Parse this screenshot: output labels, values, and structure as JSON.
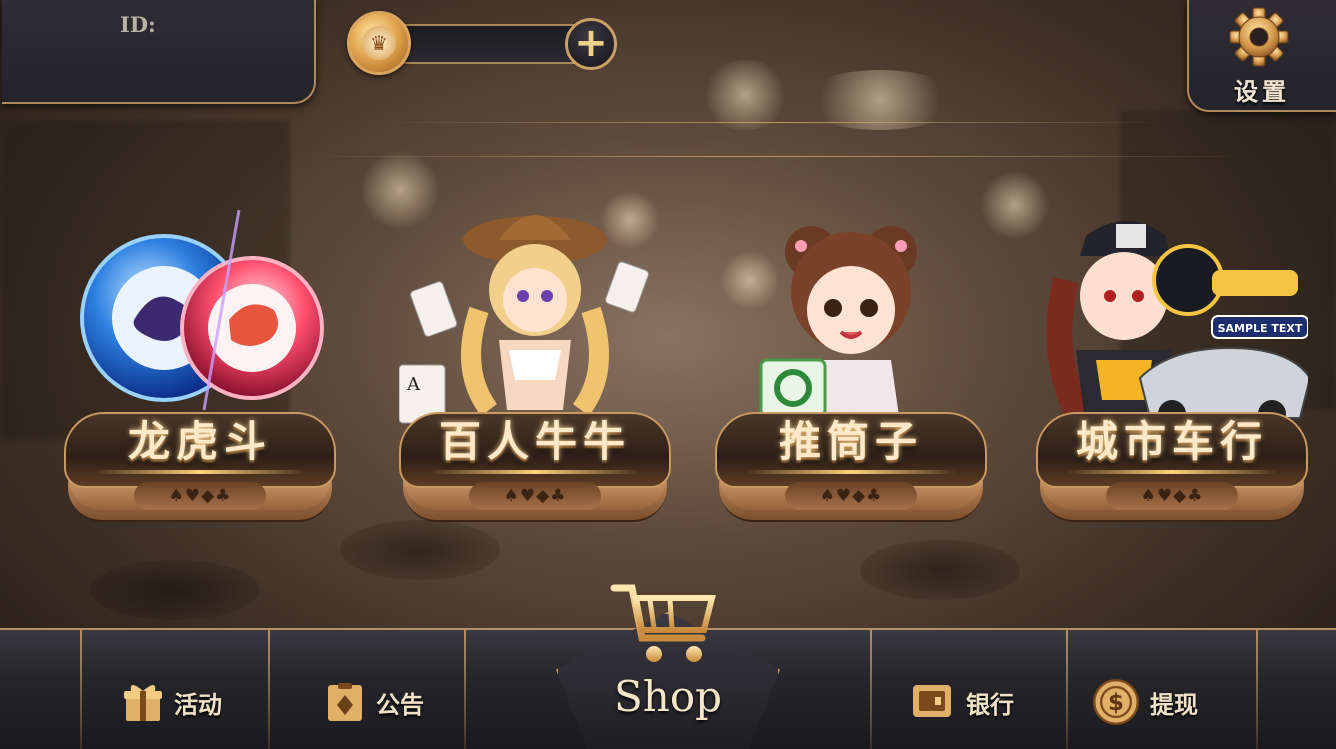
{
  "header": {
    "id_label": "ID:",
    "coin_balance": "",
    "settings_label": "设置"
  },
  "games": [
    {
      "title": "龙虎斗",
      "suits": "♠♥◆♣",
      "icon": "dragon-tiger-chips-icon"
    },
    {
      "title": "百人牛牛",
      "suits": "♠♥◆♣",
      "icon": "cowgirl-character-icon"
    },
    {
      "title": "推筒子",
      "suits": "♠♥◆♣",
      "icon": "mahjong-girl-character-icon"
    },
    {
      "title": "城市车行",
      "suits": "♠♥◆♣",
      "icon": "racing-girl-character-icon",
      "badge": "SAMPLE TEXT"
    }
  ],
  "bottom_nav": {
    "activity": "活动",
    "notice": "公告",
    "shop": "Shop",
    "bank": "银行",
    "withdraw": "提现"
  },
  "colors": {
    "gold": "#c89a62",
    "panel_dark": "#26252a",
    "title_text": "#ffe9c8"
  }
}
